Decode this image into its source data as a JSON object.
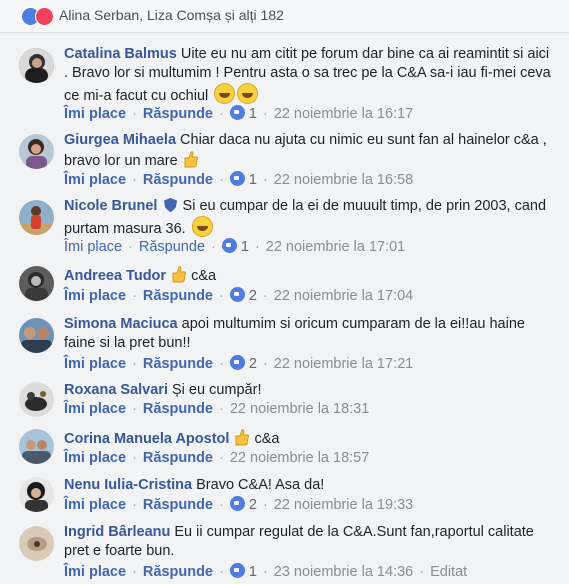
{
  "reactions": {
    "text": "Alina Serban, Liza Comșa și alți 182",
    "like_color": "#4f7ee0",
    "love_color": "#f0405c"
  },
  "labels": {
    "like": "Îmi place",
    "reply": "Răspunde",
    "edited": "Editat"
  },
  "comments": [
    {
      "name": "Catalina Balmus",
      "text": "Uite eu nu am citit pe forum dar bine ca ai reamintit si aici . Bravo lor si multumim ! Pentru asta o sa trec pe la C&A sa-i iau fi-mei ceva ce mi-a facut cu ochiul",
      "likes": "1",
      "time": "22 noiembrie la 16:17"
    },
    {
      "name": "Giurgea Mihaela",
      "text": "Chiar daca nu ajuta cu nimic eu sunt fan al hainelor c&a , bravo lor un mare",
      "likes": "1",
      "time": "22 noiembrie la 16:58"
    },
    {
      "name": "Nicole Brunel",
      "text": "Si eu cumpar de la ei de muuult timp, de prin 2003, cand purtam masura 36.",
      "likes": "1",
      "time": "22 noiembrie la 17:01"
    },
    {
      "name": "Andreea Tudor",
      "text": "c&a",
      "likes": "2",
      "time": "22 noiembrie la 17:04"
    },
    {
      "name": "Simona Maciuca",
      "text": "apoi multumim si oricum cumparam de la ei!!au haine faine si la pret bun!!",
      "likes": "2",
      "time": "22 noiembrie la 17:21"
    },
    {
      "name": "Roxana Salvari",
      "text": "Și eu cumpăr!",
      "likes": "",
      "time": "22 noiembrie la 18:31"
    },
    {
      "name": "Corina Manuela Apostol",
      "text": "c&a",
      "likes": "",
      "time": "22 noiembrie la 18:57"
    },
    {
      "name": "Nenu Iulia-Cristina",
      "text": "Bravo C&A! Asa da!",
      "likes": "2",
      "time": "22 noiembrie la 19:33"
    },
    {
      "name": "Ingrid Bârleanu",
      "text": "Eu ii cumpar regulat de la C&A.Sunt fan,raportul calitate pret e foarte bun.",
      "likes": "1",
      "time": "23 noiembrie la 14:36"
    }
  ]
}
